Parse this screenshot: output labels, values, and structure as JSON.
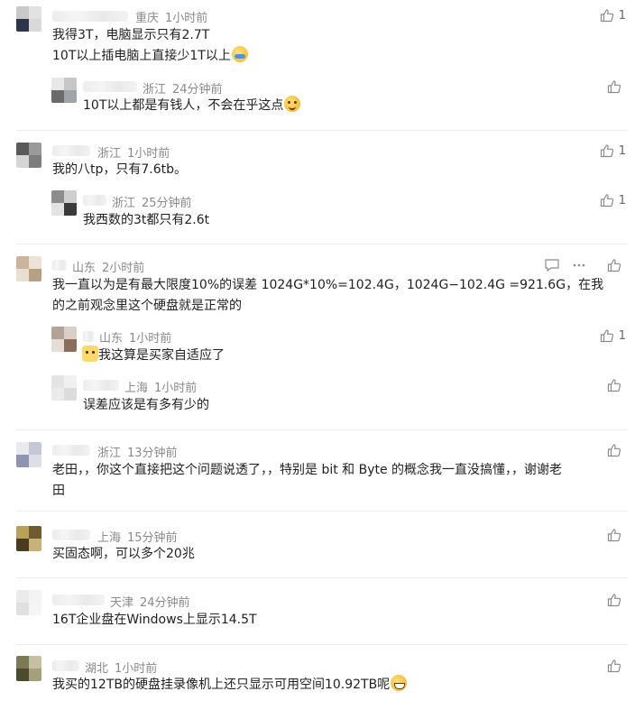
{
  "comments": [
    {
      "location": "重庆",
      "time": "1小时前",
      "lines": [
        "我得3T，电脑显示只有2.7T",
        "10T以上插电脑上直接少1T以上"
      ],
      "emoji_after": "sweat-smile-emoji",
      "likes": "1",
      "replies": [
        {
          "location": "浙江",
          "time": "24分钟前",
          "text": "10T以上都是有钱人，不会在乎这点",
          "emoji_after": "smile-emoji",
          "likes": ""
        }
      ]
    },
    {
      "location": "浙江",
      "time": "1小时前",
      "lines": [
        "我的八tp，只有7.6tb。"
      ],
      "likes": "1",
      "replies": [
        {
          "location": "浙江",
          "time": "25分钟前",
          "text": "我西数的3t都只有2.6t",
          "likes": "1"
        }
      ]
    },
    {
      "location": "山东",
      "time": "2小时前",
      "lines": [
        "我一直以为是有最大限度10%的误差 1024G*10%=102.4G，1024G−102.4G =921.6G，在我",
        "的之前观念里这个硬盘就是正常的"
      ],
      "likes": "",
      "replies": [
        {
          "location": "山东",
          "time": "1小时前",
          "text": "我这算是买家自适应了",
          "emoji_before": "cat-emoji",
          "likes": "1"
        },
        {
          "location": "上海",
          "time": "1小时前",
          "text": "误差应该是有多有少的",
          "likes": ""
        }
      ]
    },
    {
      "location": "浙江",
      "time": "13分钟前",
      "lines": [
        "老田，，你这个直接把这个问题说透了，，特别是 bit 和 Byte 的概念我一直没搞懂，，谢谢老",
        "田"
      ],
      "likes": ""
    },
    {
      "location": "上海",
      "time": "15分钟前",
      "lines": [
        "买固态啊，可以多个20兆"
      ],
      "likes": ""
    },
    {
      "location": "天津",
      "time": "24分钟前",
      "lines": [
        "16T企业盘在Windows上显示14.5T"
      ],
      "likes": ""
    },
    {
      "location": "湖北",
      "time": "1小时前",
      "lines": [
        "我买的12TB的硬盘挂录像机上还只显示可用空间10.92TB呢"
      ],
      "emoji_after": "grin-emoji",
      "likes": ""
    }
  ],
  "colors": {
    "meta": "#8a8a8a",
    "text": "#222222",
    "divider": "#ececec",
    "icon": "#8a8a8a"
  },
  "icons": {
    "like": "thumbs-up-icon",
    "reply": "comment-icon",
    "more": "more-dots-icon"
  }
}
